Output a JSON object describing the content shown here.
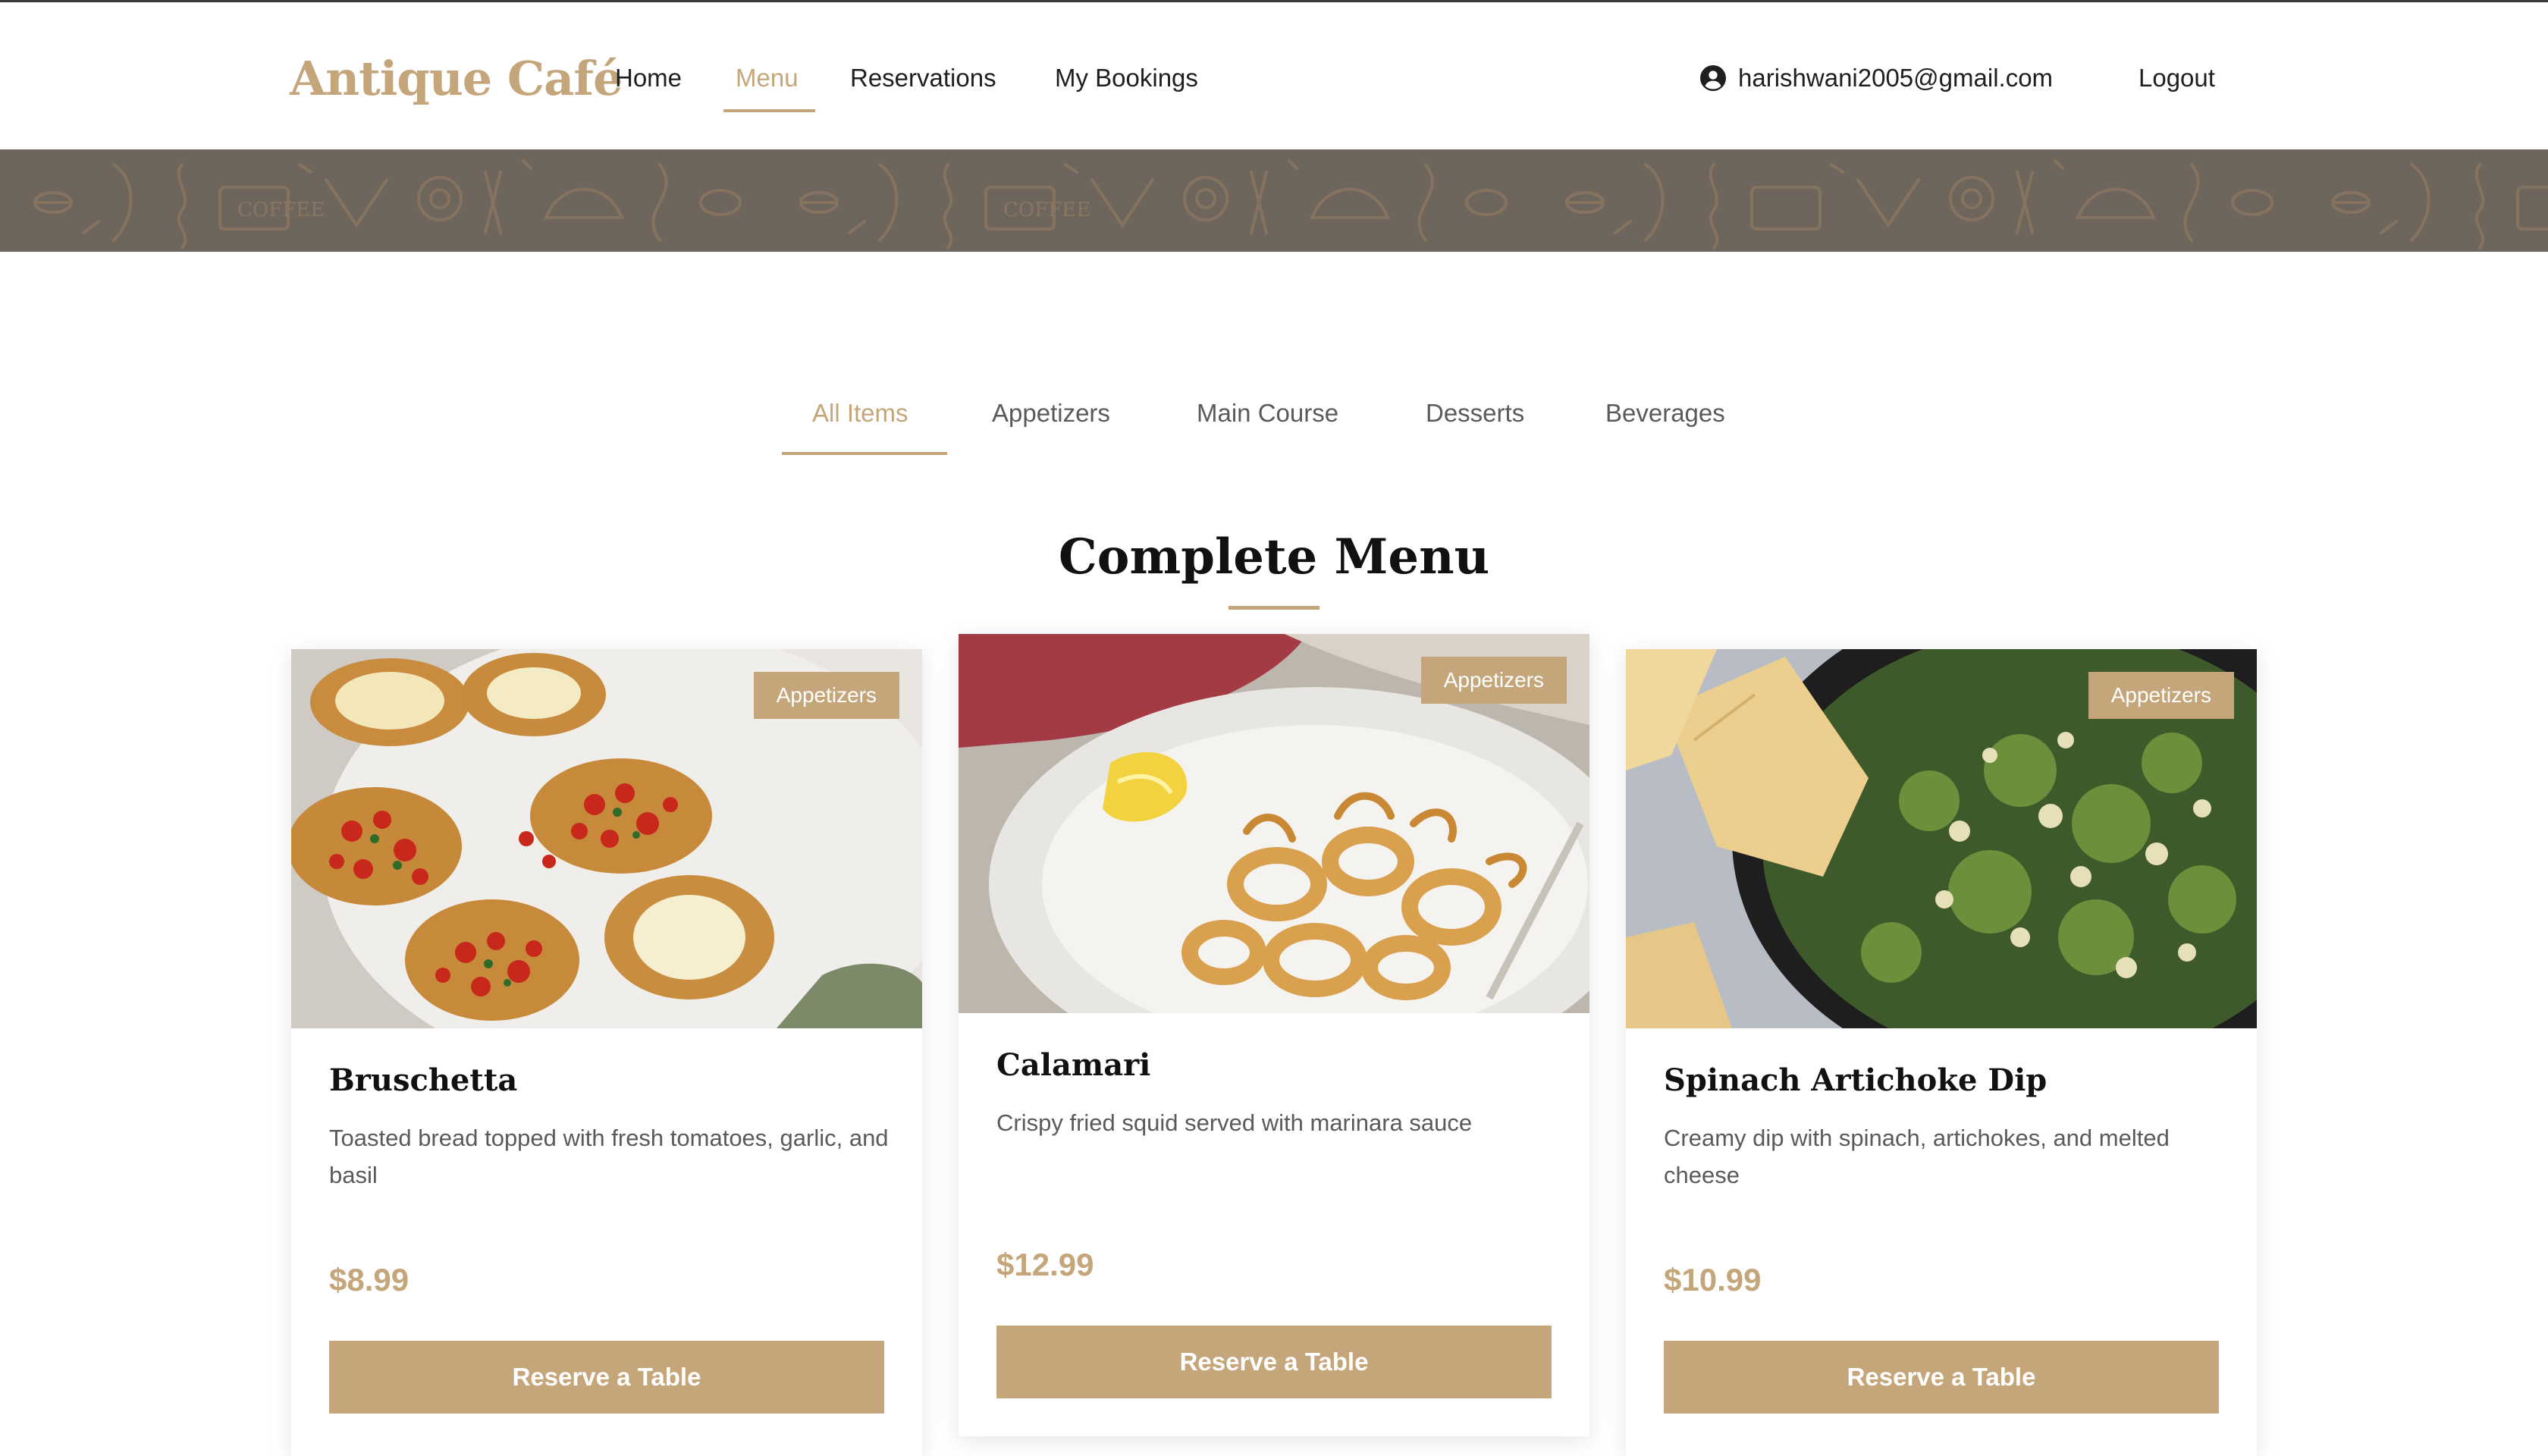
{
  "header": {
    "logo": "Antique Café",
    "nav": [
      {
        "label": "Home",
        "active": false
      },
      {
        "label": "Menu",
        "active": true
      },
      {
        "label": "Reservations",
        "active": false
      },
      {
        "label": "My Bookings",
        "active": false
      }
    ],
    "user_email": "harishwani2005@gmail.com",
    "logout_label": "Logout"
  },
  "banner": {
    "text_marks": [
      "COFFEE",
      "COFFEE"
    ]
  },
  "tabs": [
    {
      "label": "All Items",
      "active": true
    },
    {
      "label": "Appetizers",
      "active": false
    },
    {
      "label": "Main Course",
      "active": false
    },
    {
      "label": "Desserts",
      "active": false
    },
    {
      "label": "Beverages",
      "active": false
    }
  ],
  "section_title": "Complete Menu",
  "cards": [
    {
      "badge": "Appetizers",
      "title": "Bruschetta",
      "description": "Toasted bread topped with fresh tomatoes, garlic, and basil",
      "price": "$8.99",
      "button": "Reserve a Table"
    },
    {
      "badge": "Appetizers",
      "title": "Calamari",
      "description": "Crispy fried squid served with marinara sauce",
      "price": "$12.99",
      "button": "Reserve a Table"
    },
    {
      "badge": "Appetizers",
      "title": "Spinach Artichoke Dip",
      "description": "Creamy dip with spinach, artichokes, and melted cheese",
      "price": "$10.99",
      "button": "Reserve a Table"
    }
  ],
  "colors": {
    "accent": "#c4a67a",
    "text_dark": "#111111",
    "text_muted": "#5a5a5a",
    "banner_bg": "#6e655d"
  }
}
